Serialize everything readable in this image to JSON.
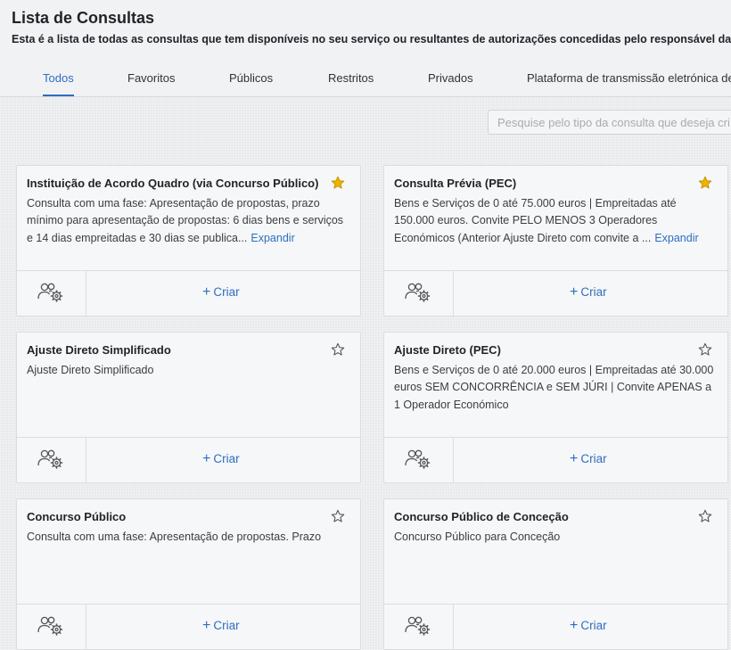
{
  "header": {
    "title": "Lista de Consultas",
    "subtitle": "Esta é a lista de todas as consultas que tem disponíveis no seu serviço ou resultantes de autorizações concedidas pelo responsável da su"
  },
  "tabs": [
    {
      "label": "Todos",
      "active": true
    },
    {
      "label": "Favoritos"
    },
    {
      "label": "Públicos"
    },
    {
      "label": "Restritos"
    },
    {
      "label": "Privados"
    },
    {
      "label": "Plataforma de transmissão eletrónica de"
    }
  ],
  "search": {
    "placeholder": "Pesquise pelo tipo da consulta que deseja cri"
  },
  "common": {
    "create_label": "Criar",
    "expand_label": "Expandir",
    "create_icon": "plus-icon",
    "footer_icon": "users-gear-icon"
  },
  "colors": {
    "accent": "#2f6dc2",
    "star_filled": "#f0b400",
    "star_outline": "#555555"
  },
  "cards": [
    {
      "title": "Instituição de Acordo Quadro (via Concurso Público)",
      "favorite": true,
      "description": "Consulta com uma fase: Apresentação de propostas, prazo mínimo para apresentação de propostas: 6 dias bens e serviços e 14 dias empreitadas e 30 dias se publica...",
      "expandable": true
    },
    {
      "title": "Consulta Prévia (PEC)",
      "favorite": true,
      "description": "Bens e Serviços de 0 até 75.000 euros | Empreitadas até 150.000 euros. Convite PELO MENOS 3 Operadores Económicos (Anterior Ajuste Direto com convite a ...",
      "expandable": true
    },
    {
      "title": "Ajuste Direto Simplificado",
      "favorite": false,
      "description": "Ajuste Direto Simplificado",
      "expandable": false
    },
    {
      "title": "Ajuste Direto (PEC)",
      "favorite": false,
      "description": "Bens e Serviços de 0 até 20.000 euros | Empreitadas até 30.000 euros SEM CONCORRÊNCIA e SEM JÚRI | Convite APENAS a 1 Operador Económico",
      "expandable": false
    },
    {
      "title": "Concurso Público",
      "favorite": false,
      "description": "Consulta com uma fase: Apresentação de propostas. Prazo",
      "expandable": false
    },
    {
      "title": "Concurso Público de Conceção",
      "favorite": false,
      "description": "Concurso Público para Conceção",
      "expandable": false
    }
  ]
}
